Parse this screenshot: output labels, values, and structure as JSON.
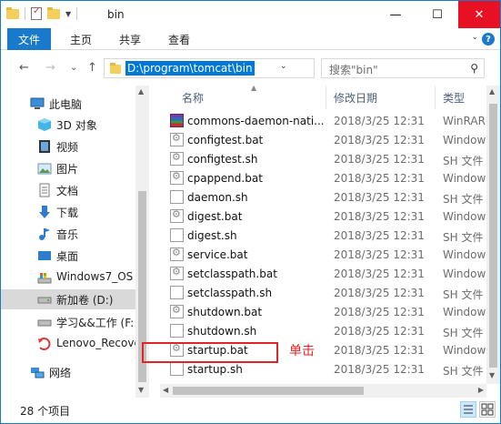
{
  "window": {
    "title": "bin",
    "controls": {
      "minimize": "—",
      "maximize": "☐",
      "close": "✕"
    }
  },
  "ribbon": {
    "tabs": [
      "文件",
      "主页",
      "共享",
      "查看"
    ],
    "expand_icon": "chevron-down-icon",
    "help_icon": "?"
  },
  "nav": {
    "back": "←",
    "forward": "→",
    "recent": "⌄",
    "up": "↑",
    "address": "D:\\program\\tomcat\\bin",
    "address_dropdown": "⌄",
    "refresh": "↻",
    "search_placeholder": "搜索\"bin\"",
    "search_icon": "⚲"
  },
  "sidebar": {
    "items": [
      {
        "label": "此电脑",
        "icon": "computer-icon",
        "selected": false
      },
      {
        "label": "3D 对象",
        "icon": "cube-icon",
        "selected": false
      },
      {
        "label": "视频",
        "icon": "video-icon",
        "selected": false
      },
      {
        "label": "图片",
        "icon": "picture-icon",
        "selected": false
      },
      {
        "label": "文档",
        "icon": "document-icon",
        "selected": false
      },
      {
        "label": "下载",
        "icon": "download-icon",
        "selected": false
      },
      {
        "label": "音乐",
        "icon": "music-icon",
        "selected": false
      },
      {
        "label": "桌面",
        "icon": "desktop-icon",
        "selected": false
      },
      {
        "label": "Windows7_OS",
        "icon": "drive-os-icon",
        "selected": false
      },
      {
        "label": "新加卷 (D:)",
        "icon": "drive-icon",
        "selected": true
      },
      {
        "label": "学习&&工作 (F:",
        "icon": "drive-icon",
        "selected": false
      },
      {
        "label": "Lenovo_Recove",
        "icon": "recovery-drive-icon",
        "selected": false
      },
      {
        "label": "网络",
        "icon": "network-icon",
        "selected": false
      }
    ]
  },
  "files": {
    "columns": {
      "name": "名称",
      "date": "修改日期",
      "type": "类型"
    },
    "rows": [
      {
        "name": "commons-daemon-nati...",
        "date": "2018/3/25 12:31",
        "type": "WinRAR",
        "icon": "rar"
      },
      {
        "name": "configtest.bat",
        "date": "2018/3/25 12:31",
        "type": "Window",
        "icon": "gear"
      },
      {
        "name": "configtest.sh",
        "date": "2018/3/25 12:31",
        "type": "SH 文件",
        "icon": "gear"
      },
      {
        "name": "cpappend.bat",
        "date": "2018/3/25 12:31",
        "type": "Window",
        "icon": "gear"
      },
      {
        "name": "daemon.sh",
        "date": "2018/3/25 12:31",
        "type": "SH 文件",
        "icon": "plain"
      },
      {
        "name": "digest.bat",
        "date": "2018/3/25 12:31",
        "type": "Window",
        "icon": "gear"
      },
      {
        "name": "digest.sh",
        "date": "2018/3/25 12:31",
        "type": "SH 文件",
        "icon": "plain"
      },
      {
        "name": "service.bat",
        "date": "2018/3/25 12:31",
        "type": "Window",
        "icon": "gear"
      },
      {
        "name": "setclasspath.bat",
        "date": "2018/3/25 12:31",
        "type": "Window",
        "icon": "gear"
      },
      {
        "name": "setclasspath.sh",
        "date": "2018/3/25 12:31",
        "type": "SH 文件",
        "icon": "plain"
      },
      {
        "name": "shutdown.bat",
        "date": "2018/3/25 12:31",
        "type": "Window",
        "icon": "gear"
      },
      {
        "name": "shutdown.sh",
        "date": "2018/3/25 12:31",
        "type": "SH 文件",
        "icon": "plain"
      },
      {
        "name": "startup.bat",
        "date": "2018/3/25 12:31",
        "type": "Window",
        "icon": "gear"
      },
      {
        "name": "startup.sh",
        "date": "2018/3/25 12:31",
        "type": "SH 文件",
        "icon": "plain"
      }
    ]
  },
  "annotation": {
    "text": "单击",
    "color": "#e42424"
  },
  "status": {
    "count": "28 个项目"
  },
  "colors": {
    "accent": "#1979ca",
    "close": "#e81123",
    "selection": "#0078d7"
  }
}
